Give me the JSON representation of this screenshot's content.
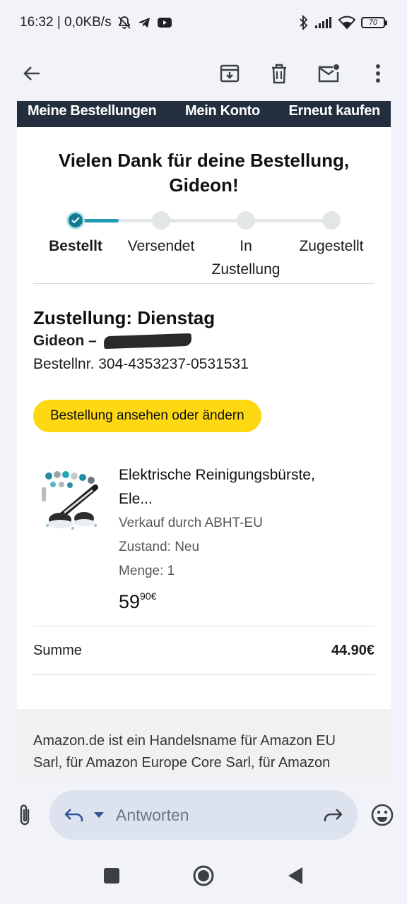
{
  "status_bar": {
    "time_speed": "16:32 | 0,0KB/s",
    "battery": "70"
  },
  "toolbar": {
    "back": "arrow-back-icon",
    "archive": "archive-icon",
    "delete": "trash-icon",
    "mark_unread": "mail-unread-icon",
    "more": "more-vert-icon"
  },
  "email": {
    "nav": [
      "Meine Bestellungen",
      "Mein Konto",
      "Erneut kaufen"
    ],
    "thanks_line1": "Vielen Dank für deine Bestellung,",
    "thanks_line2": "Gideon!",
    "progress": {
      "steps": [
        "Bestellt",
        "Versendet",
        "In Zustellung",
        "Zugestellt"
      ],
      "current_step": 1,
      "step_line2": "Zustellung",
      "step_line1_in": "In"
    },
    "delivery_title": "Zustellung: Dienstag",
    "recipient": "Gideon –",
    "order_number": "Bestellnr. 304-4353237-0531531",
    "cta": "Bestellung ansehen oder ändern",
    "item": {
      "title_line1": "Elektrische Reinigungsbürste,",
      "title_line2": "Ele...",
      "seller": "Verkauf durch ABHT-EU",
      "condition": "Zustand: Neu",
      "quantity": "Menge: 1",
      "price_whole": "59",
      "price_frac": "90€"
    },
    "sum_label": "Summe",
    "sum_value": "44.90€",
    "footer_line1": "Amazon.de ist ein Handelsname für Amazon EU",
    "footer_line2": "Sarl, für Amazon Europe Core Sarl, für Amazon"
  },
  "reply": {
    "placeholder": "Antworten"
  },
  "colors": {
    "amazon_nav": "#232f3e",
    "cta_yellow": "#ffd814",
    "progress_teal": "#0e7d91"
  }
}
